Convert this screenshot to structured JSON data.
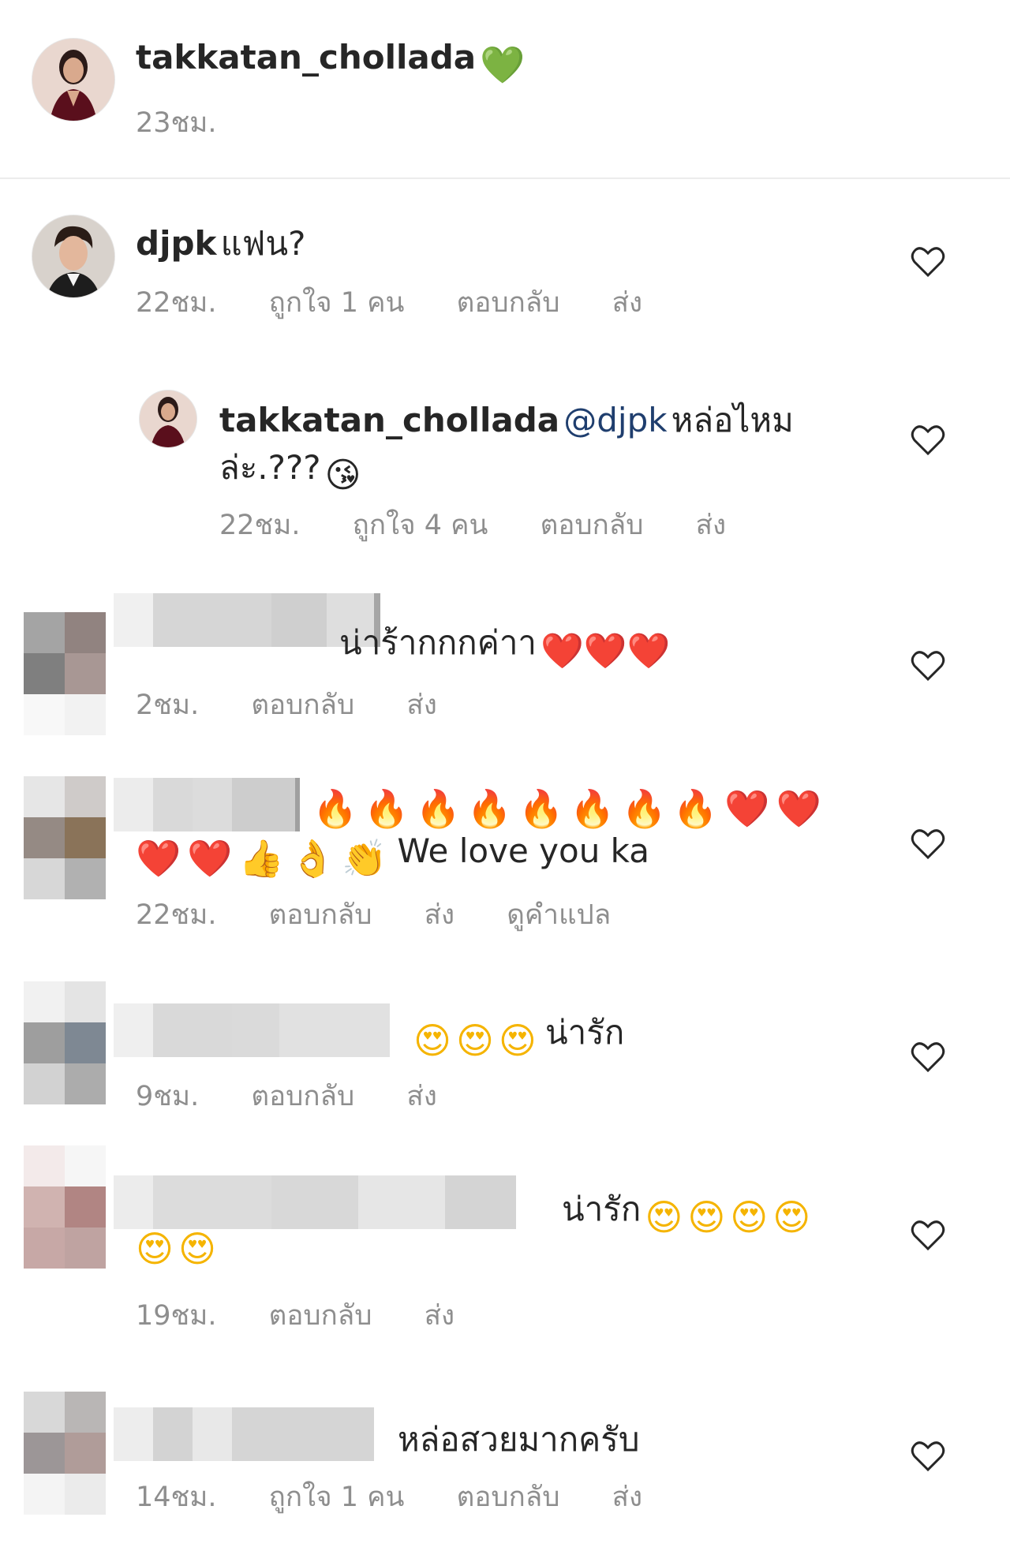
{
  "caption": {
    "username": "takkatan_chollada",
    "emoji": "💚",
    "time": "23ชม."
  },
  "comments": [
    {
      "username": "djpk",
      "text": "แฟน?",
      "time": "22ชม.",
      "likes": "ถูกใจ 1 คน",
      "reply": "ตอบกลับ",
      "send": "ส่ง"
    },
    {
      "username": "takkatan_chollada",
      "mention": "@djpk",
      "text": "หล่อไหม",
      "text2": "ล่ะ.???",
      "emoji": "😘",
      "time": "22ชม.",
      "likes": "ถูกใจ 4 คน",
      "reply": "ตอบกลับ",
      "send": "ส่ง"
    },
    {
      "text": "น่าร้ากกกค่าา",
      "emoji": "❤️❤️❤️",
      "time": "2ชม.",
      "reply": "ตอบกลับ",
      "send": "ส่ง"
    },
    {
      "emoji_line1": "🔥🔥🔥🔥🔥🔥🔥🔥❤️❤️",
      "emoji_line2": "❤️❤️👍👌👏",
      "text": "We love you ka",
      "time": "22ชม.",
      "reply": "ตอบกลับ",
      "send": "ส่ง",
      "translate": "ดูคำแปล"
    },
    {
      "emoji": "😍😍😍",
      "text": "น่ารัก",
      "time": "9ชม.",
      "reply": "ตอบกลับ",
      "send": "ส่ง"
    },
    {
      "text": "น่ารัก",
      "emoji_line1": "😍😍😍😍",
      "emoji_line2": "😍😍",
      "time": "19ชม.",
      "reply": "ตอบกลับ",
      "send": "ส่ง"
    },
    {
      "text": "หล่อสวยมากครับ",
      "time": "14ชม.",
      "likes": "ถูกใจ 1 คน",
      "reply": "ตอบกลับ",
      "send": "ส่ง"
    }
  ],
  "icons": {
    "like": "heart-outline-icon"
  },
  "colors": {
    "text": "#262626",
    "meta": "#8e8e8e",
    "mention": "#1f3e6e",
    "verified_heart": "#2ecc40"
  }
}
